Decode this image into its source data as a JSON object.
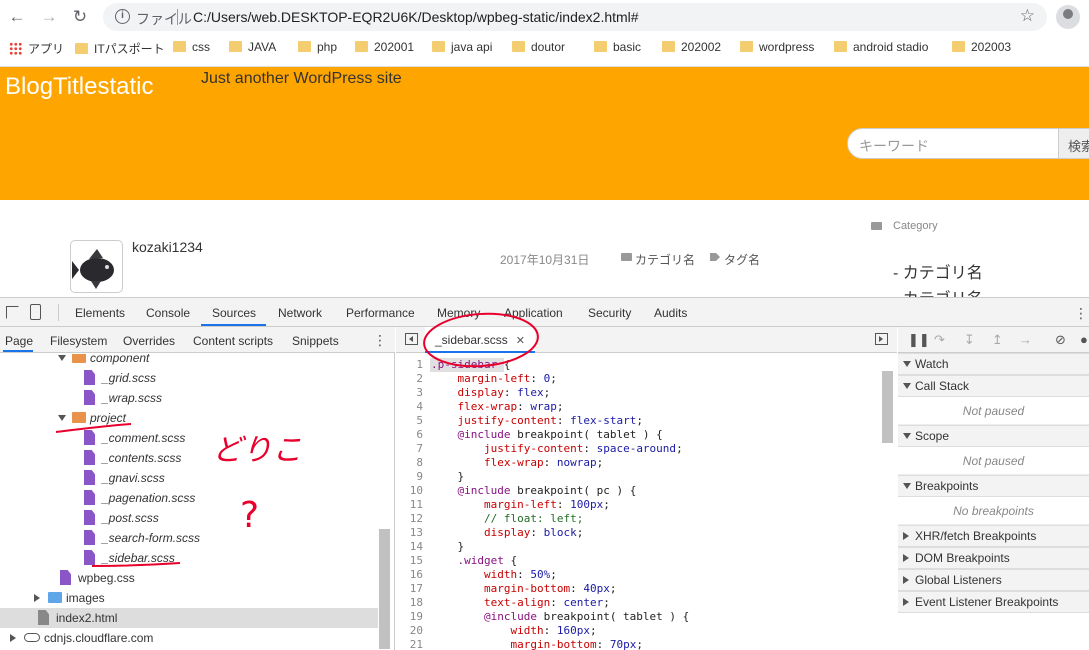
{
  "browser": {
    "scheme_label": "ファイル",
    "url": "C:/Users/web.DESKTOP-EQR2U6K/Desktop/wpbeg-static/index2.html#",
    "bookmarks": [
      "アプリ",
      "ITパスポート",
      "css",
      "JAVA",
      "php",
      "202001",
      "java api",
      "doutor",
      "basic",
      "202002",
      "wordpress",
      "android stadio",
      "202003"
    ]
  },
  "site": {
    "blog_title": "BlogTitlestatic",
    "tagline": "Just another WordPress site",
    "search_placeholder": "キーワード",
    "search_button": "検索",
    "author": "kozaki1234",
    "date": "2017年10月31日",
    "category": "カテゴリ名",
    "tag": "タグ名",
    "sidebar_heading": "Category",
    "sidebar_items": [
      "- カテゴリ名",
      "- カテゴリ名"
    ]
  },
  "devtools": {
    "tabs": [
      "Elements",
      "Console",
      "Sources",
      "Network",
      "Performance",
      "Memory",
      "Application",
      "Security",
      "Audits"
    ],
    "active_tab": "Sources",
    "navigator_tabs": [
      "Page",
      "Filesystem",
      "Overrides",
      "Content scripts",
      "Snippets"
    ],
    "tree": [
      {
        "label": "component",
        "kind": "folder",
        "open": true,
        "italic": true
      },
      {
        "label": "_grid.scss",
        "kind": "file",
        "italic": true
      },
      {
        "label": "_wrap.scss",
        "kind": "file",
        "italic": true
      },
      {
        "label": "project",
        "kind": "folder",
        "open": true,
        "italic": true
      },
      {
        "label": "_comment.scss",
        "kind": "file",
        "italic": true
      },
      {
        "label": "_contents.scss",
        "kind": "file",
        "italic": true
      },
      {
        "label": "_gnavi.scss",
        "kind": "file",
        "italic": true
      },
      {
        "label": "_pagenation.scss",
        "kind": "file",
        "italic": true
      },
      {
        "label": "_post.scss",
        "kind": "file",
        "italic": true
      },
      {
        "label": "_search-form.scss",
        "kind": "file",
        "italic": true
      },
      {
        "label": "_sidebar.scss",
        "kind": "file",
        "italic": true
      },
      {
        "label": "wpbeg.css",
        "kind": "file",
        "italic": false
      },
      {
        "label": "images",
        "kind": "folder",
        "open": false,
        "italic": false
      },
      {
        "label": "index2.html",
        "kind": "html",
        "italic": false
      },
      {
        "label": "cdnjs.cloudflare.com",
        "kind": "cloud",
        "italic": false
      }
    ],
    "editor_tab": "_sidebar.scss",
    "code_lines": [
      ".p-sidebar {",
      "    margin-left: 0;",
      "    display: flex;",
      "    flex-wrap: wrap;",
      "    justify-content: flex-start;",
      "    @include breakpoint( tablet ) {",
      "        justify-content: space-around;",
      "        flex-wrap: nowrap;",
      "    }",
      "    @include breakpoint( pc ) {",
      "        margin-left: 100px;",
      "        // float: left;",
      "        display: block;",
      "    }",
      "    .widget {",
      "        width: 50%;",
      "        margin-bottom: 40px;",
      "        text-align: center;",
      "        @include breakpoint( tablet ) {",
      "            width: 160px;",
      "            margin-bottom: 70px;"
    ],
    "debugger_sections": [
      {
        "title": "Watch",
        "open": true,
        "empty": ""
      },
      {
        "title": "Call Stack",
        "open": true,
        "empty": "Not paused"
      },
      {
        "title": "Scope",
        "open": true,
        "empty": "Not paused"
      },
      {
        "title": "Breakpoints",
        "open": true,
        "empty": "No breakpoints"
      },
      {
        "title": "XHR/fetch Breakpoints",
        "open": false,
        "empty": ""
      },
      {
        "title": "DOM Breakpoints",
        "open": false,
        "empty": ""
      },
      {
        "title": "Global Listeners",
        "open": false,
        "empty": ""
      },
      {
        "title": "Event Listener Breakpoints",
        "open": false,
        "empty": ""
      }
    ]
  },
  "annotations": {
    "handwritten_text": "どりこ",
    "question_mark": "?"
  },
  "colors": {
    "header_orange": "#ffa500",
    "scss_file": "#8a56c7",
    "folder_orange": "#e8924a",
    "folder_blue": "#5ea6e8",
    "annotation_red": "#e8002d"
  }
}
